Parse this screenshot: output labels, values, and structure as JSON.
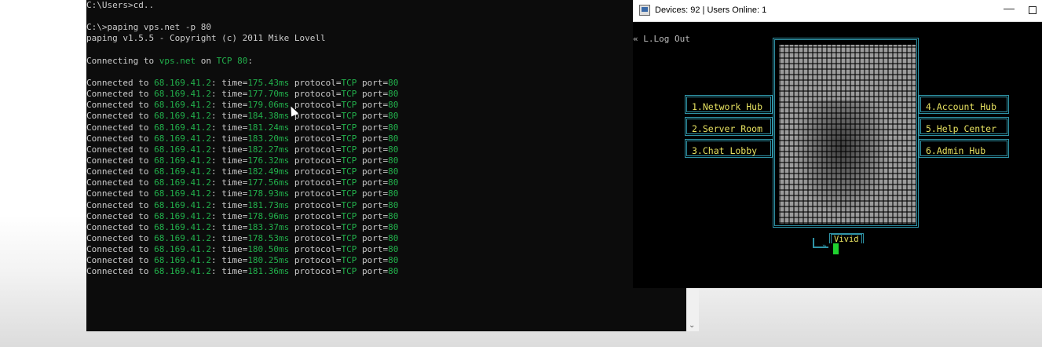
{
  "console": {
    "lines": [
      {
        "text": "C:\\Users>cd.."
      },
      {
        "text": ""
      },
      {
        "text": "C:\\>paping vps.net -p 80"
      },
      {
        "text": "paping v1.5.5 - Copyright (c) 2011 Mike Lovell"
      },
      {
        "text": ""
      },
      {
        "prefix": "Connecting to ",
        "host": "vps.net",
        "mid": " on ",
        "proto": "TCP",
        "space": " ",
        "port": "80",
        "suffix": ":"
      }
    ],
    "blank_after": "",
    "pings": [
      {
        "ip": "68.169.41.2",
        "time": "175.43ms"
      },
      {
        "ip": "68.169.41.2",
        "time": "177.70ms"
      },
      {
        "ip": "68.169.41.2",
        "time": "179.06ms"
      },
      {
        "ip": "68.169.41.2",
        "time": "184.38ms"
      },
      {
        "ip": "68.169.41.2",
        "time": "181.24ms"
      },
      {
        "ip": "68.169.41.2",
        "time": "183.20ms"
      },
      {
        "ip": "68.169.41.2",
        "time": "182.27ms"
      },
      {
        "ip": "68.169.41.2",
        "time": "176.32ms"
      },
      {
        "ip": "68.169.41.2",
        "time": "182.49ms"
      },
      {
        "ip": "68.169.41.2",
        "time": "177.56ms"
      },
      {
        "ip": "68.169.41.2",
        "time": "178.93ms"
      },
      {
        "ip": "68.169.41.2",
        "time": "181.73ms"
      },
      {
        "ip": "68.169.41.2",
        "time": "178.96ms"
      },
      {
        "ip": "68.169.41.2",
        "time": "183.37ms"
      },
      {
        "ip": "68.169.41.2",
        "time": "178.53ms"
      },
      {
        "ip": "68.169.41.2",
        "time": "180.50ms"
      },
      {
        "ip": "68.169.41.2",
        "time": "180.25ms"
      },
      {
        "ip": "68.169.41.2",
        "time": "181.36ms"
      }
    ],
    "ping_labels": {
      "connected": "Connected to ",
      "time": ": time=",
      "protocol": " protocol=",
      "protocol_value": "TCP",
      "port": " port=",
      "port_value": "80"
    },
    "colors": {
      "text": "#cccccc",
      "highlight": "#22b14c",
      "background": "#0c0c0c"
    }
  },
  "app_window": {
    "title": "Devices: 92 | Users Online: 1",
    "minimize_glyph": "—",
    "logout": "« L.Log Out",
    "menu_left": [
      "1.Network Hub",
      "2.Server Room",
      "3.Chat Lobby"
    ],
    "menu_right": [
      "4.Account Hub",
      "5.Help Center",
      "6.Admin Hub"
    ],
    "username": "Vivid",
    "prompt_glyph": "»",
    "colors": {
      "frame": "#2f93a6",
      "menu_text": "#e5e060",
      "cursor": "#1fd12f"
    }
  }
}
